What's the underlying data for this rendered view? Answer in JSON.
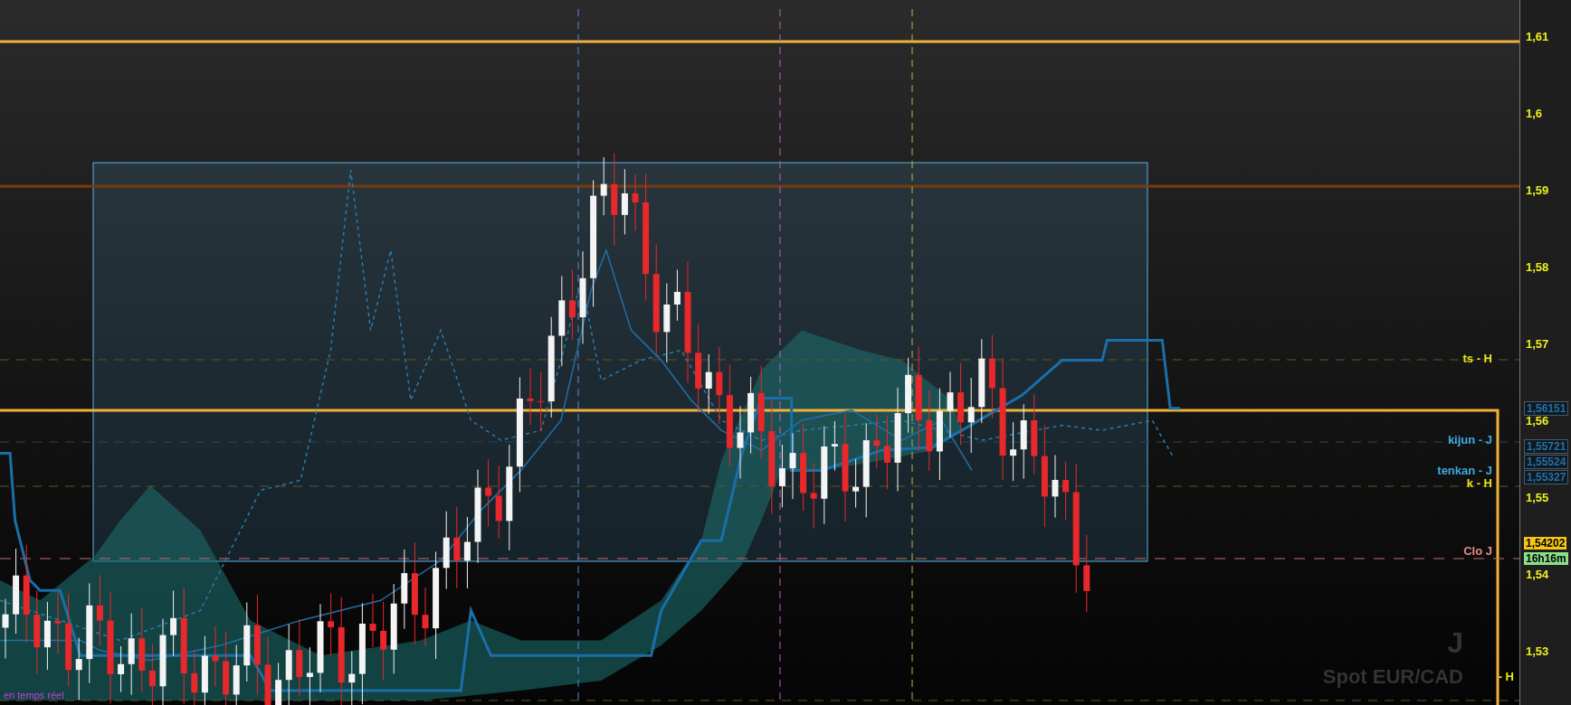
{
  "chart": {
    "instrument": "Spot EUR/CAD",
    "period": "J",
    "status": "en temps réel"
  },
  "axis": {
    "ticks": [
      "1,61",
      "1,6",
      "1,59",
      "1,58",
      "1,57",
      "1,56",
      "1,55",
      "1,54",
      "1,53"
    ]
  },
  "line_labels": [
    {
      "text": "ts - H",
      "color": "#e6e619"
    },
    {
      "text": "kijun - J",
      "color": "#3fa9e0"
    },
    {
      "text": "tenkan - J",
      "color": "#3fa9e0"
    },
    {
      "text": "k - H",
      "color": "#e6e619"
    },
    {
      "text": "Clo J",
      "color": "#e88a8a"
    },
    {
      "text": "- H",
      "color": "#e6e619"
    }
  ],
  "price_tags": [
    {
      "text": "1,56151",
      "kind": "indicator"
    },
    {
      "text": "1,55721",
      "kind": "indicator"
    },
    {
      "text": "1,55524",
      "kind": "indicator"
    },
    {
      "text": "1,55327",
      "kind": "indicator"
    },
    {
      "text": "1,54202",
      "kind": "last"
    },
    {
      "text": "16h16m",
      "kind": "timer"
    }
  ]
}
